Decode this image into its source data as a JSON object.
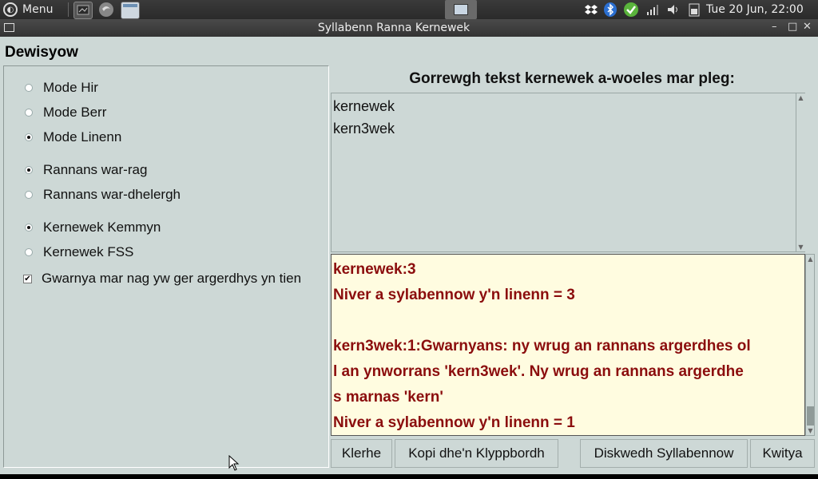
{
  "panel": {
    "menu_label": "Menu",
    "clock": "Tue 20 Jun, 22:00"
  },
  "window": {
    "title": "Syllabenn Ranna Kernewek",
    "controls": {
      "minimize": "–",
      "maximize": "□",
      "close": "✕"
    }
  },
  "options": {
    "heading": "Dewisyow",
    "mode": [
      {
        "label": "Mode Hir",
        "selected": false
      },
      {
        "label": "Mode Berr",
        "selected": false
      },
      {
        "label": "Mode Linenn",
        "selected": true
      }
    ],
    "split": [
      {
        "label": "Rannans war-rag",
        "selected": true
      },
      {
        "label": "Rannans war-dhelergh",
        "selected": false
      }
    ],
    "orthography": [
      {
        "label": "Kernewek Kemmyn",
        "selected": true
      },
      {
        "label": "Kernewek FSS",
        "selected": false
      }
    ],
    "warn_checkbox": {
      "label": "Gwarnya mar nag yw ger argerdhys yn tien",
      "checked": true
    }
  },
  "input": {
    "prompt": "Gorrewgh tekst kernewek a-woeles mar pleg:",
    "lines": [
      "kernewek",
      "kern3wek"
    ]
  },
  "output": {
    "lines": [
      "kernewek:3",
      "Niver a sylabennow y'n linenn = 3",
      "",
      "kern3wek:1:Gwarnyans: ny wrug an rannans argerdhes ol",
      "l an ynworrans 'kern3wek'. Ny wrug an rannans argerdhe",
      "s marnas 'kern'",
      "Niver a sylabennow y'n linenn = 1"
    ]
  },
  "buttons": {
    "clear": "Klerhe",
    "copy": "Kopi dhe'n Klyppbordh",
    "export": "Diskwedh Syllabennow",
    "quit": "Kwitya"
  },
  "colors": {
    "window_bg": "#cdd8d6",
    "output_bg": "#fffce0",
    "output_text": "#8b0d0d"
  }
}
